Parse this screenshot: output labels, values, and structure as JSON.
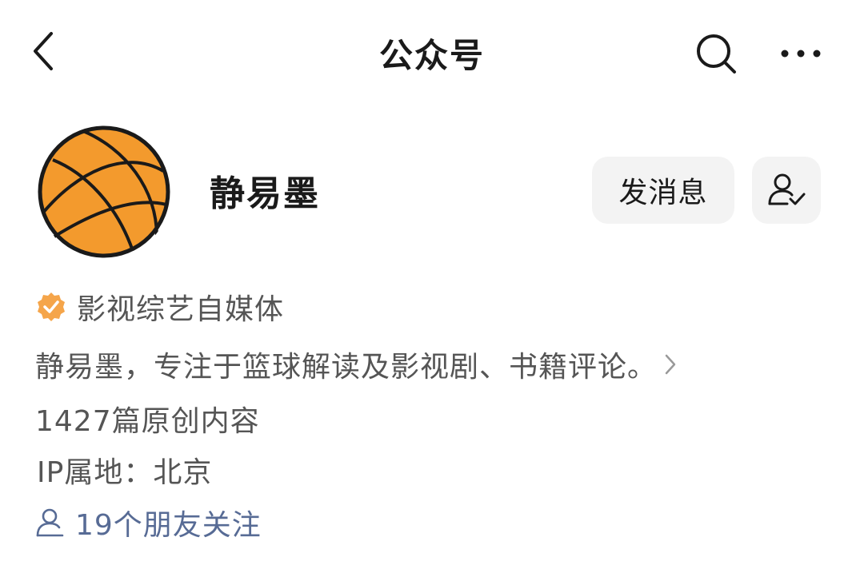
{
  "nav": {
    "title": "公众号",
    "back_icon": "chevron-left-icon",
    "search_icon": "search-icon",
    "more_icon": "more-dots-icon"
  },
  "profile": {
    "avatar_icon": "basketball-avatar",
    "name": "静易墨",
    "message_button": "发消息",
    "follow_icon": "user-check-icon"
  },
  "info": {
    "verify_icon": "verified-badge-icon",
    "verify_text": "影视综艺自媒体",
    "description": "静易墨，专注于篮球解读及影视剧、书籍评论。",
    "articles": "1427篇原创内容",
    "ip": "IP属地：北京",
    "friends_icon": "user-outline-icon",
    "friends": "19个朋友关注"
  },
  "colors": {
    "accent_badge": "#f5a54a",
    "link": "#576b95",
    "avatar": "#f39a2d"
  }
}
